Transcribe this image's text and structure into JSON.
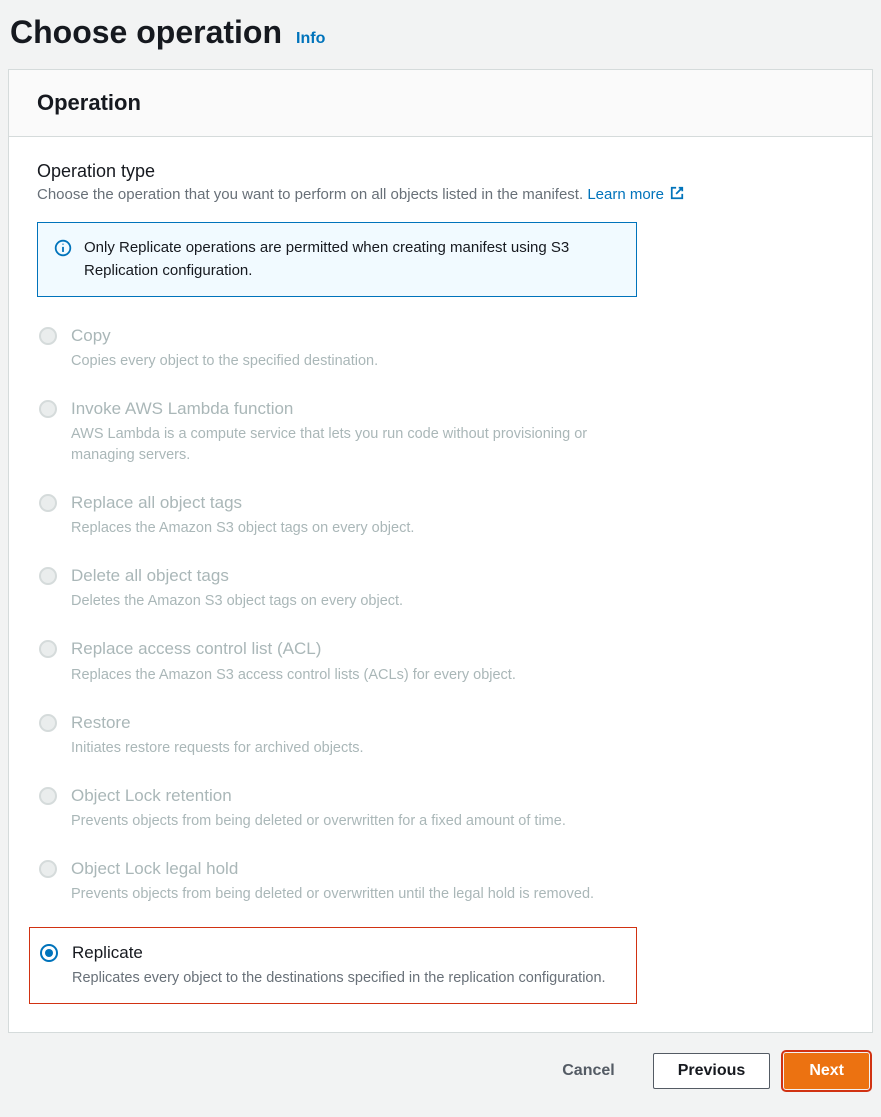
{
  "header": {
    "title": "Choose operation",
    "info_label": "Info"
  },
  "panel": {
    "title": "Operation"
  },
  "section": {
    "title": "Operation type",
    "subtitle_prefix": "Choose the operation that you want to perform on all objects listed in the manifest. ",
    "learn_more": "Learn more"
  },
  "alert": {
    "text": "Only Replicate operations are permitted when creating manifest using S3 Replication configuration."
  },
  "options": [
    {
      "id": "copy",
      "label": "Copy",
      "desc": "Copies every object to the specified destination.",
      "disabled": true,
      "selected": false
    },
    {
      "id": "invoke-lambda",
      "label": "Invoke AWS Lambda function",
      "desc": "AWS Lambda is a compute service that lets you run code without provisioning or managing servers.",
      "disabled": true,
      "selected": false
    },
    {
      "id": "replace-tags",
      "label": "Replace all object tags",
      "desc": "Replaces the Amazon S3 object tags on every object.",
      "disabled": true,
      "selected": false
    },
    {
      "id": "delete-tags",
      "label": "Delete all object tags",
      "desc": "Deletes the Amazon S3 object tags on every object.",
      "disabled": true,
      "selected": false
    },
    {
      "id": "replace-acl",
      "label": "Replace access control list (ACL)",
      "desc": "Replaces the Amazon S3 access control lists (ACLs) for every object.",
      "disabled": true,
      "selected": false
    },
    {
      "id": "restore",
      "label": "Restore",
      "desc": "Initiates restore requests for archived objects.",
      "disabled": true,
      "selected": false
    },
    {
      "id": "object-lock-retention",
      "label": "Object Lock retention",
      "desc": "Prevents objects from being deleted or overwritten for a fixed amount of time.",
      "disabled": true,
      "selected": false
    },
    {
      "id": "object-lock-legal-hold",
      "label": "Object Lock legal hold",
      "desc": "Prevents objects from being deleted or overwritten until the legal hold is removed.",
      "disabled": true,
      "selected": false
    },
    {
      "id": "replicate",
      "label": "Replicate",
      "desc": "Replicates every object to the destinations specified in the replication configuration.",
      "disabled": false,
      "selected": true,
      "highlighted": true
    }
  ],
  "footer": {
    "cancel": "Cancel",
    "previous": "Previous",
    "next": "Next"
  }
}
